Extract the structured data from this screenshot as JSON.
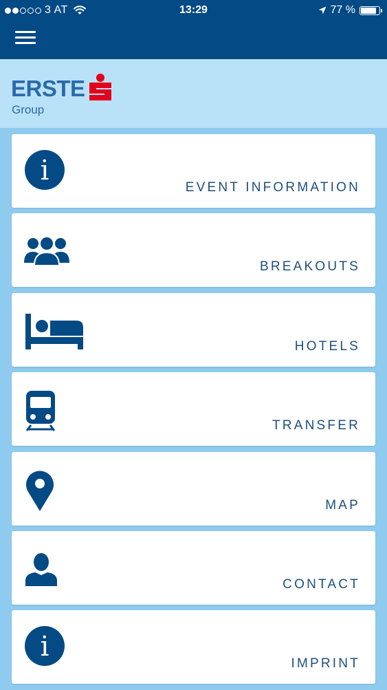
{
  "status_bar": {
    "carrier": "3 AT",
    "time": "13:29",
    "battery": "77 %",
    "signal_strength": 2,
    "signal_max": 5
  },
  "header": {
    "menu_icon": "hamburger-icon",
    "logo_text": "ERSTE",
    "logo_sub": "Group",
    "logo_mark_color": "#e3001b"
  },
  "colors": {
    "primary": "#044a84",
    "logo_band": "#b9e2f8",
    "background": "#8fcbef",
    "text": "#1d4f7d",
    "brand_red": "#e3001b"
  },
  "menu": {
    "items": [
      {
        "label": "EVENT INFORMATION",
        "icon": "info-icon"
      },
      {
        "label": "BREAKOUTS",
        "icon": "group-icon"
      },
      {
        "label": "HOTELS",
        "icon": "bed-icon"
      },
      {
        "label": "TRANSFER",
        "icon": "train-icon"
      },
      {
        "label": "MAP",
        "icon": "location-pin-icon"
      },
      {
        "label": "CONTACT",
        "icon": "person-icon"
      },
      {
        "label": "IMPRINT",
        "icon": "info-icon"
      }
    ]
  }
}
